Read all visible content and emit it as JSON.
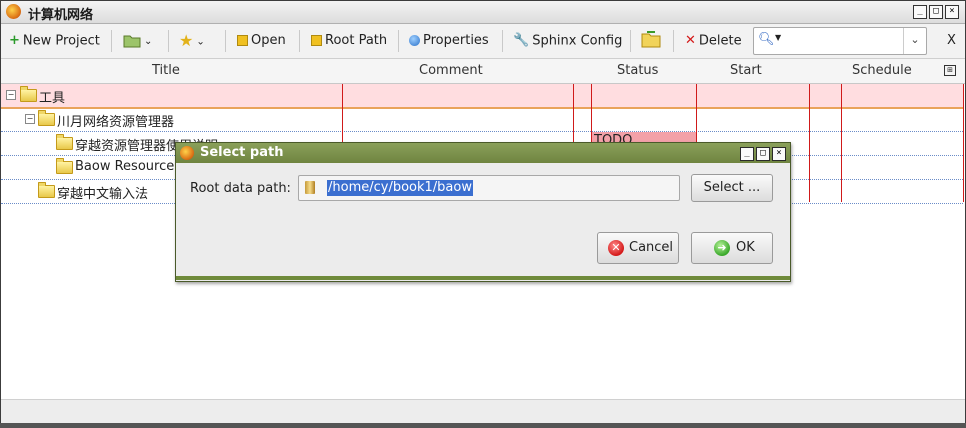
{
  "window": {
    "title": "计算机网络",
    "minimize": "_",
    "maximize": "□",
    "close": "×"
  },
  "toolbar": {
    "new_project": "New Project",
    "open": "Open",
    "root_path": "Root Path",
    "properties": "Properties",
    "sphinx_config": "Sphinx Config",
    "delete": "Delete",
    "clear": "X"
  },
  "columns": {
    "title": "Title",
    "comment": "Comment",
    "status": "Status",
    "start": "Start",
    "schedule": "Schedule"
  },
  "tree": {
    "rows": [
      {
        "label": "工具",
        "expander": "−"
      },
      {
        "label": "川月网络资源管理器",
        "expander": "−"
      },
      {
        "label": "穿越资源管理器使用说明",
        "status": "TODO"
      },
      {
        "label": "Baow Resource"
      },
      {
        "label": "穿越中文输入法"
      }
    ]
  },
  "dialog": {
    "title": "Select path",
    "root_label": "Root data path:",
    "root_value": "/home/cy/book1/baow",
    "select_button": "Select ...",
    "cancel_button": "Cancel",
    "ok_button": "OK"
  },
  "colors": {
    "dialog_title": "#7a8f4a",
    "selected_row": "#ffdde0",
    "column_divider": "#d01a1a",
    "todo_status": "#f3a1a8"
  }
}
